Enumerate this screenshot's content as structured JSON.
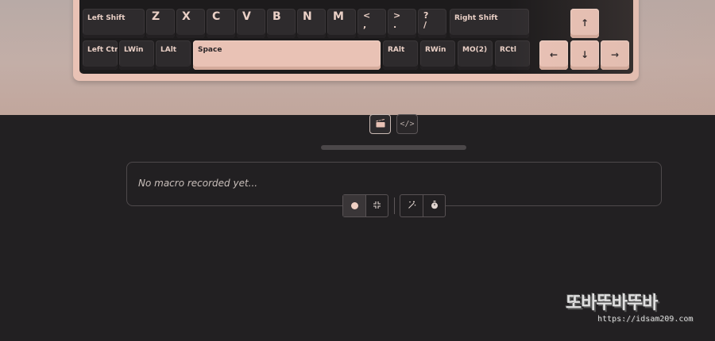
{
  "keyboard": {
    "row_bottom_ghost": [
      "",
      "",
      "",
      "",
      "",
      "",
      "",
      "",
      "",
      "",
      "",
      ""
    ],
    "row_shift": {
      "left_shift": "Left Shift",
      "letters": [
        "Z",
        "X",
        "C",
        "V",
        "B",
        "N",
        "M"
      ],
      "comma": "<\n,",
      "period": ">\n.",
      "slash": "?\n/",
      "right_shift": "Right Shift",
      "up_arrow": "↑"
    },
    "row_space": {
      "left_ctrl": "Left Ctrl",
      "lwin": "LWin",
      "lalt": "LAlt",
      "space": "Space",
      "ralt": "RAlt",
      "rwin": "RWin",
      "mo2": "MO(2)",
      "rctl": "RCtl",
      "left_arrow": "←",
      "down_arrow": "↓",
      "right_arrow": "→"
    },
    "colors": {
      "accent": "#e9c2b5",
      "keycap": "#2e2b2d",
      "plate": "#1d1b1c"
    }
  },
  "mode_toggle": {
    "buttons": [
      {
        "icon": "clapperboard-icon",
        "glyph": "🎬",
        "active": true
      },
      {
        "icon": "code-icon",
        "glyph": "</>",
        "active": false
      }
    ]
  },
  "progress": {
    "fraction": 0.0
  },
  "macro": {
    "empty_text": "No macro recorded yet...",
    "controls": [
      {
        "icon": "record-icon",
        "glyph": ""
      },
      {
        "icon": "compress-icon",
        "glyph": "⤡"
      },
      {
        "icon": "magic-wand-icon",
        "glyph": "✧"
      },
      {
        "icon": "timer-icon",
        "glyph": "⏱"
      }
    ]
  },
  "watermark": {
    "text": "또바뚜바뚜바",
    "url": "https://idsam209.com"
  }
}
